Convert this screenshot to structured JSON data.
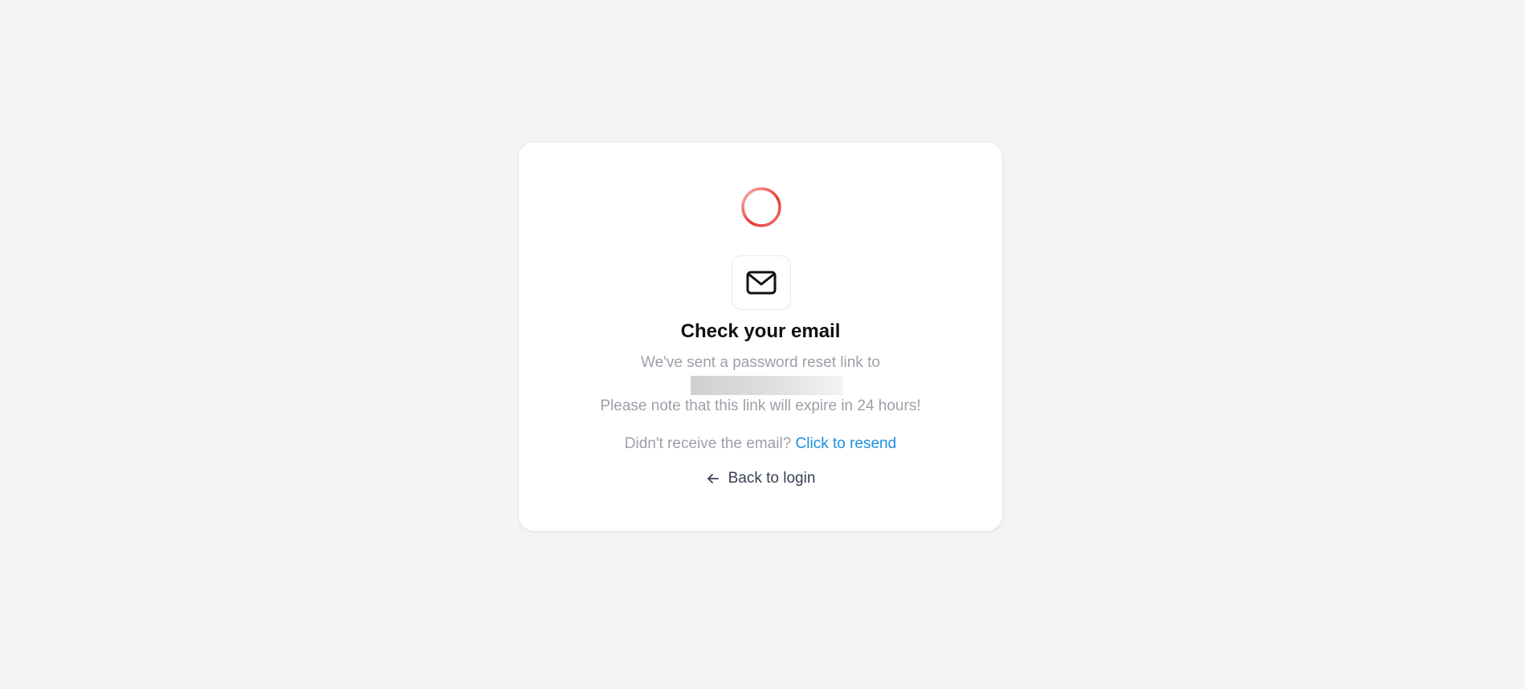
{
  "card": {
    "title": "Check your email",
    "sent_text": "We've sent a password reset link to",
    "expiry_text": "Please note that this link will expire in 24 hours!",
    "resend_prompt": "Didn't receive the email?",
    "resend_link": "Click to resend",
    "back_label": "Back to login"
  },
  "icons": {
    "loading": "loading-spinner-icon",
    "mail": "mail-icon",
    "back": "arrow-left-icon"
  },
  "colors": {
    "background": "#f3f4f6",
    "accent_link": "#1e90e0",
    "spinner": "#e53935",
    "muted_text": "#9ca0a8"
  }
}
